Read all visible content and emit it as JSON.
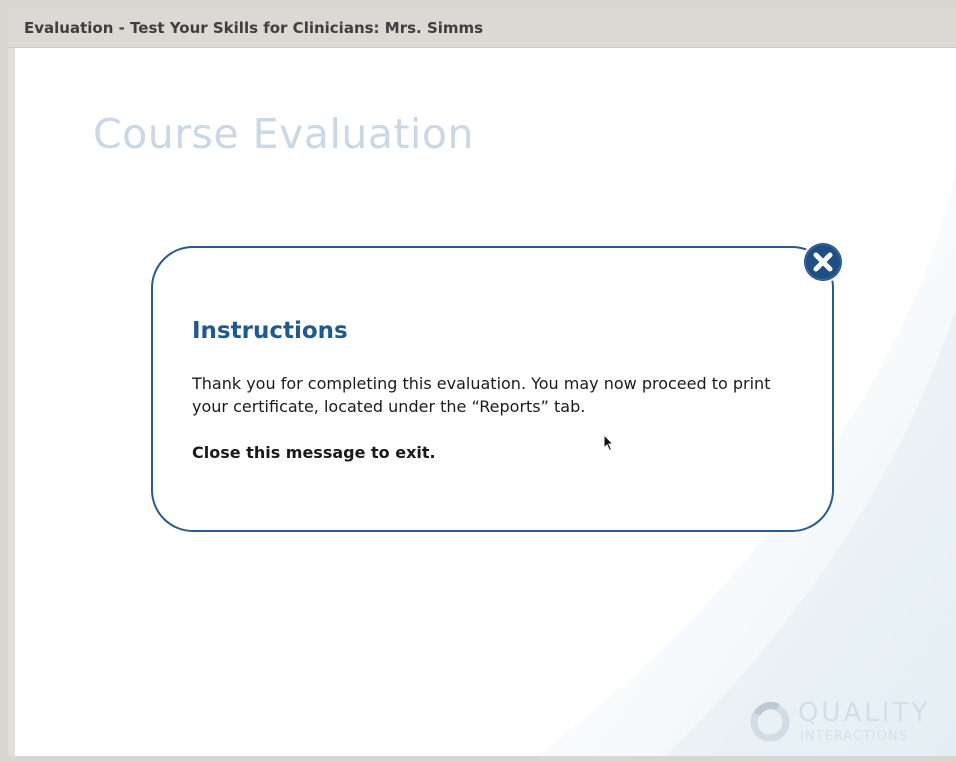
{
  "window": {
    "title": "Evaluation - Test Your Skills for Clinicians: Mrs. Simms"
  },
  "page": {
    "heading": "Course Evaluation"
  },
  "dialog": {
    "title": "Instructions",
    "body": "Thank you for completing this evaluation. You may now proceed to print your certificate, located under the “Reports” tab.",
    "note": "Close this message to exit.",
    "close_icon": "close-icon"
  },
  "logo": {
    "name": "QUALITY",
    "sub": "INTERACTIONS"
  },
  "colors": {
    "accent": "#1f5a8e",
    "dialog_border": "#2a5a8c",
    "heading_faded": "#c9d7e6",
    "title_bar": "#dcd8d3"
  }
}
